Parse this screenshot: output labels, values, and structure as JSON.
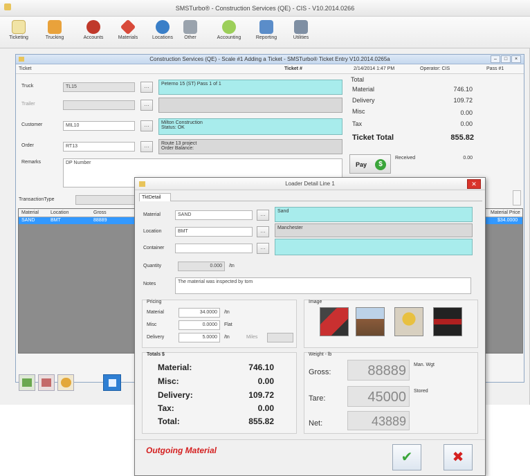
{
  "app": {
    "title": "SMSTurbo® - Construction Services (QE) - CIS - V10.2014.0266"
  },
  "toolbar": {
    "items": [
      "Ticketing",
      "Trucking",
      "Accounts",
      "Materials",
      "Locations",
      "Other",
      "Accounting",
      "Reporting",
      "Utilities"
    ]
  },
  "ticket_window": {
    "title": "Construction Services (QE) - Scale #1 Adding a Ticket - SMSTurbo® Ticket Entry V10.2014.0265a",
    "tab": "Ticket",
    "ticket_no_label": "Ticket #",
    "datetime": "2/14/2014 1:47 PM",
    "operator": "Operator: CIS",
    "pass": "Pass #1",
    "truck_label": "Truck",
    "truck_value": "TL15",
    "truck_info": "Peterno 15 (ST) Pass 1 of 1",
    "trailer_label": "Trailer",
    "customer_label": "Customer",
    "customer_value": "MIL10",
    "customer_info_1": "Milton Construction",
    "customer_info_2": "Status: OK",
    "order_label": "Order",
    "order_value": "RT13",
    "order_info_1": "Route 13 project",
    "order_info_2": "Order Balance:",
    "remarks_label": "Remarks",
    "remarks_value": "DP Number",
    "totals": {
      "header": "Total",
      "material_label": "Material",
      "material_value": "746.10",
      "delivery_label": "Delivery",
      "delivery_value": "109.72",
      "misc_label": "Misc",
      "misc_value": "0.00",
      "tax_label": "Tax",
      "tax_value": "0.00",
      "ticket_total_label": "Ticket Total",
      "ticket_total_value": "855.82"
    },
    "pay_label": "Pay",
    "received_label": "Received",
    "received_value": "0.00",
    "transaction_type_label": "TransactionType",
    "grid": {
      "columns": [
        "Material",
        "Location",
        "Gross"
      ],
      "row": [
        "SAND",
        "BMT",
        "88889"
      ],
      "right_col_header": "Material Price",
      "right_col_value": "$34.0000"
    }
  },
  "dialog": {
    "title": "Loader Detail Line 1",
    "tab": "TktDetail",
    "material_label": "Material",
    "material_value": "SAND",
    "material_info": "Sand",
    "location_label": "Location",
    "location_value": "BMT",
    "location_info": "Manchester",
    "container_label": "Container",
    "quantity_label": "Quantity",
    "quantity_value": "0.000",
    "quantity_unit": "/tn",
    "notes_label": "Notes",
    "notes_value": "The material was inspected by tom",
    "pricing": {
      "header": "Pricing",
      "material_label": "Material",
      "material_value": "34.0000",
      "material_unit": "/tn",
      "misc_label": "Misc",
      "misc_value": "0.0000",
      "misc_unit": "Flat",
      "delivery_label": "Delivery",
      "delivery_value": "5.0000",
      "delivery_unit": "/tn",
      "miles_label": "Miles"
    },
    "image_label": "Image",
    "totals": {
      "header": "Totals $",
      "material_label": "Material:",
      "material_value": "746.10",
      "misc_label": "Misc:",
      "misc_value": "0.00",
      "delivery_label": "Delivery:",
      "delivery_value": "109.72",
      "tax_label": "Tax:",
      "tax_value": "0.00",
      "total_label": "Total:",
      "total_value": "855.82"
    },
    "weight": {
      "header": "Weight - lb",
      "gross_label": "Gross:",
      "gross_value": "88889",
      "gross_note": "Man. Wgt",
      "tare_label": "Tare:",
      "tare_value": "45000",
      "tare_note": "Stored",
      "net_label": "Net:",
      "net_value": "43889"
    },
    "footer_status": "Outgoing Material",
    "ok_icon": "✔",
    "cancel_icon": "✖"
  },
  "colors": {
    "cyan": "#a8ecec",
    "selection": "#3399ff",
    "status_red": "#d42020",
    "accent_green": "#3aa53a"
  }
}
